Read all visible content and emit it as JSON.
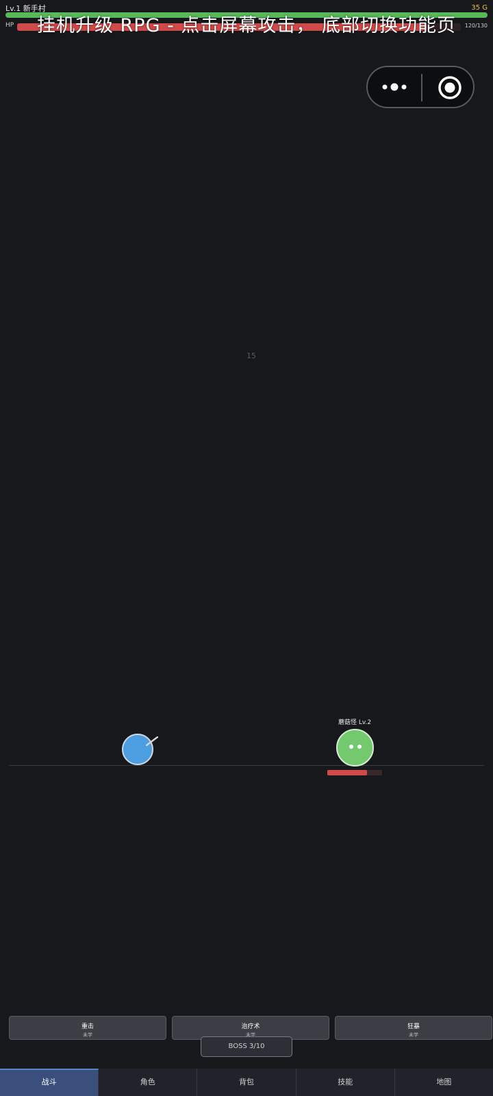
{
  "hud": {
    "level_location": "Lv.1 新手村",
    "gold": "35 G",
    "xp_progress": 1.0,
    "hp_label": "HP",
    "hp_value": "120/130",
    "hp_progress": 0.923
  },
  "overlay": {
    "title": "挂机升级 RPG - 点击屏幕攻击， 底部切换功能页"
  },
  "capsule": {
    "more_icon": "more-dots-icon",
    "close_icon": "close-target-icon"
  },
  "battle": {
    "damage_number": "15",
    "enemy": {
      "name": "蘑菇怪 Lv.2",
      "hp_progress": 0.72
    }
  },
  "skills": [
    {
      "name": "重击",
      "status": "未学"
    },
    {
      "name": "治疗术",
      "status": "未学"
    },
    {
      "name": "狂暴",
      "status": "未学"
    }
  ],
  "boss": {
    "label": "BOSS 3/10"
  },
  "tabs": [
    {
      "label": "战斗",
      "active": true
    },
    {
      "label": "角色",
      "active": false
    },
    {
      "label": "背包",
      "active": false
    },
    {
      "label": "技能",
      "active": false
    },
    {
      "label": "地图",
      "active": false
    }
  ],
  "colors": {
    "background": "#17181c",
    "xp_bar": "#58b85a",
    "hp_bar": "#d04a4a",
    "gold_text": "#e8c04a",
    "player": "#4d9ee0",
    "enemy": "#74c96f",
    "active_tab": "#3a4f7c"
  }
}
